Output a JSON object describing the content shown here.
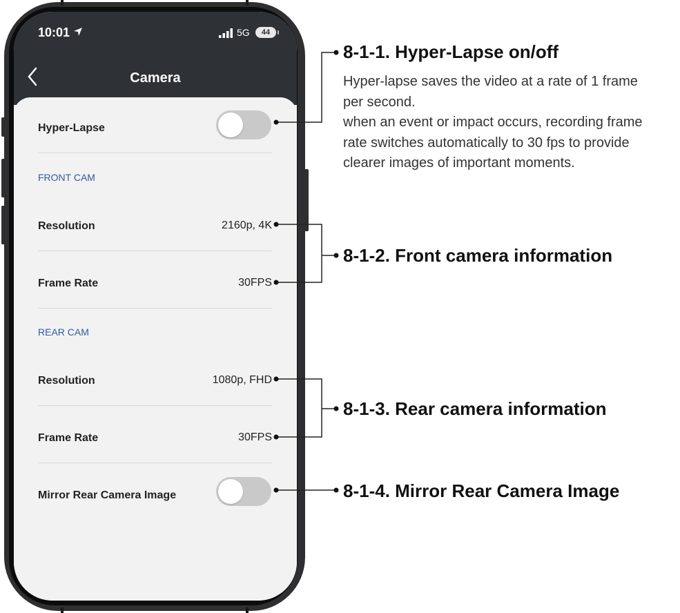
{
  "status": {
    "time": "10:01",
    "network": "5G",
    "battery": "44"
  },
  "nav": {
    "title": "Camera"
  },
  "settings": {
    "hyper_lapse_label": "Hyper-Lapse",
    "hyper_lapse_on": false,
    "front_section": "FRONT CAM",
    "front_resolution_label": "Resolution",
    "front_resolution_value": "2160p, 4K",
    "front_frame_rate_label": "Frame Rate",
    "front_frame_rate_value": "30FPS",
    "rear_section": "REAR CAM",
    "rear_resolution_label": "Resolution",
    "rear_resolution_value": "1080p, FHD",
    "rear_frame_rate_label": "Frame Rate",
    "rear_frame_rate_value": "30FPS",
    "mirror_label": "Mirror Rear Camera Image",
    "mirror_on": false
  },
  "callouts": {
    "c1_title": "8-1-1. Hyper-Lapse on/off",
    "c1_desc": [
      "Hyper-lapse saves the video at a rate of 1 frame",
      "per second.",
      "when an event or impact occurs, recording frame",
      "rate switches automatically to 30 fps to provide",
      "clearer images of important moments."
    ],
    "c2_title": "8-1-2. Front camera information",
    "c3_title": "8-1-3. Rear camera information",
    "c4_title": "8-1-4. Mirror Rear Camera Image"
  },
  "colors": {
    "topbar": "#2e3135",
    "section_text": "#2f5aa0",
    "toggle_off": "#c9c9c9"
  }
}
